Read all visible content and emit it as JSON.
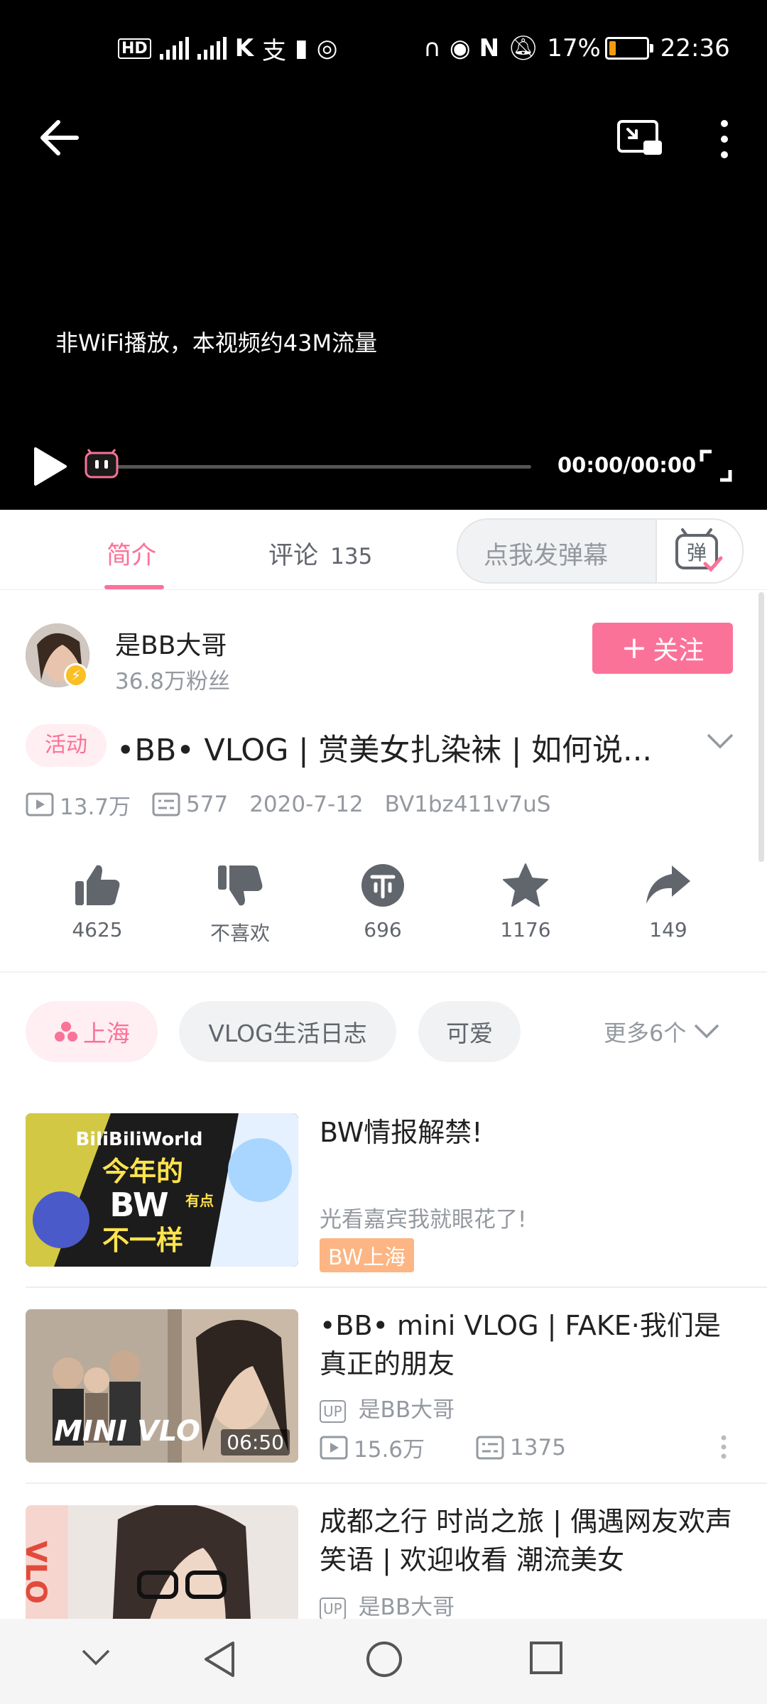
{
  "status_bar": {
    "left_icons": [
      "hd-icon",
      "4g-signal-icon",
      "4g-signal-icon",
      "app-k-icon",
      "alipay-icon",
      "sim-alert-icon",
      "hotspot-icon"
    ],
    "right_icons": [
      "headset-icon",
      "eye-comfort-icon",
      "nfc-icon",
      "mute-icon"
    ],
    "battery_percent": "17%",
    "battery_level": 0.17,
    "time": "22:36"
  },
  "player": {
    "notice": "非WiFi播放，本视频约43M流量",
    "time": "00:00/00:00",
    "progress": 0.0
  },
  "tabs": {
    "intro": "简介",
    "comments": "评论",
    "comments_count": "135",
    "danmaku_placeholder": "点我发弹幕",
    "danmaku_button": "弹"
  },
  "uploader": {
    "name": "是BB大哥",
    "fans": "36.8万粉丝",
    "follow_label": "关注",
    "follow_plus": "+"
  },
  "video": {
    "tag": "活动",
    "title": "•BB• VLOG | 赏美女扎染袜 | 如何说...",
    "views": "13.7万",
    "danmaku": "577",
    "date": "2020-7-12",
    "bvid": "BV1bz411v7uS"
  },
  "actions": {
    "like": "4625",
    "dislike": "不喜欢",
    "coin": "696",
    "favorite": "1176",
    "share": "149"
  },
  "tags": {
    "location": "上海",
    "vlog": "VLOG生活日志",
    "cute": "可爱",
    "more": "更多6个"
  },
  "recommendations": [
    {
      "title": "BW情报解禁!",
      "subtitle": "光看嘉宾我就眼花了!",
      "badge": "BW上海",
      "thumb_text_1": "BiliBiliWorld",
      "thumb_text_2": "今年的",
      "thumb_text_3": "BW",
      "thumb_text_4": "有点",
      "thumb_text_5": "不一样"
    },
    {
      "title": "•BB• mini VLOG | FAKE·我们是真正的朋友",
      "up_label": "UP",
      "uploader": "是BB大哥",
      "views": "15.6万",
      "danmaku": "1375",
      "duration": "06:50",
      "thumb_text": "MINI VLO"
    },
    {
      "title": "成都之行 时尚之旅 | 偶遇网友欢声笑语 | 欢迎收看 潮流美女",
      "up_label": "UP",
      "uploader": "是BB大哥",
      "thumb_text": "VLO"
    }
  ],
  "colors": {
    "accent": "#fb7299",
    "muted": "#9499a0",
    "badge_orange": "#fcb583"
  }
}
